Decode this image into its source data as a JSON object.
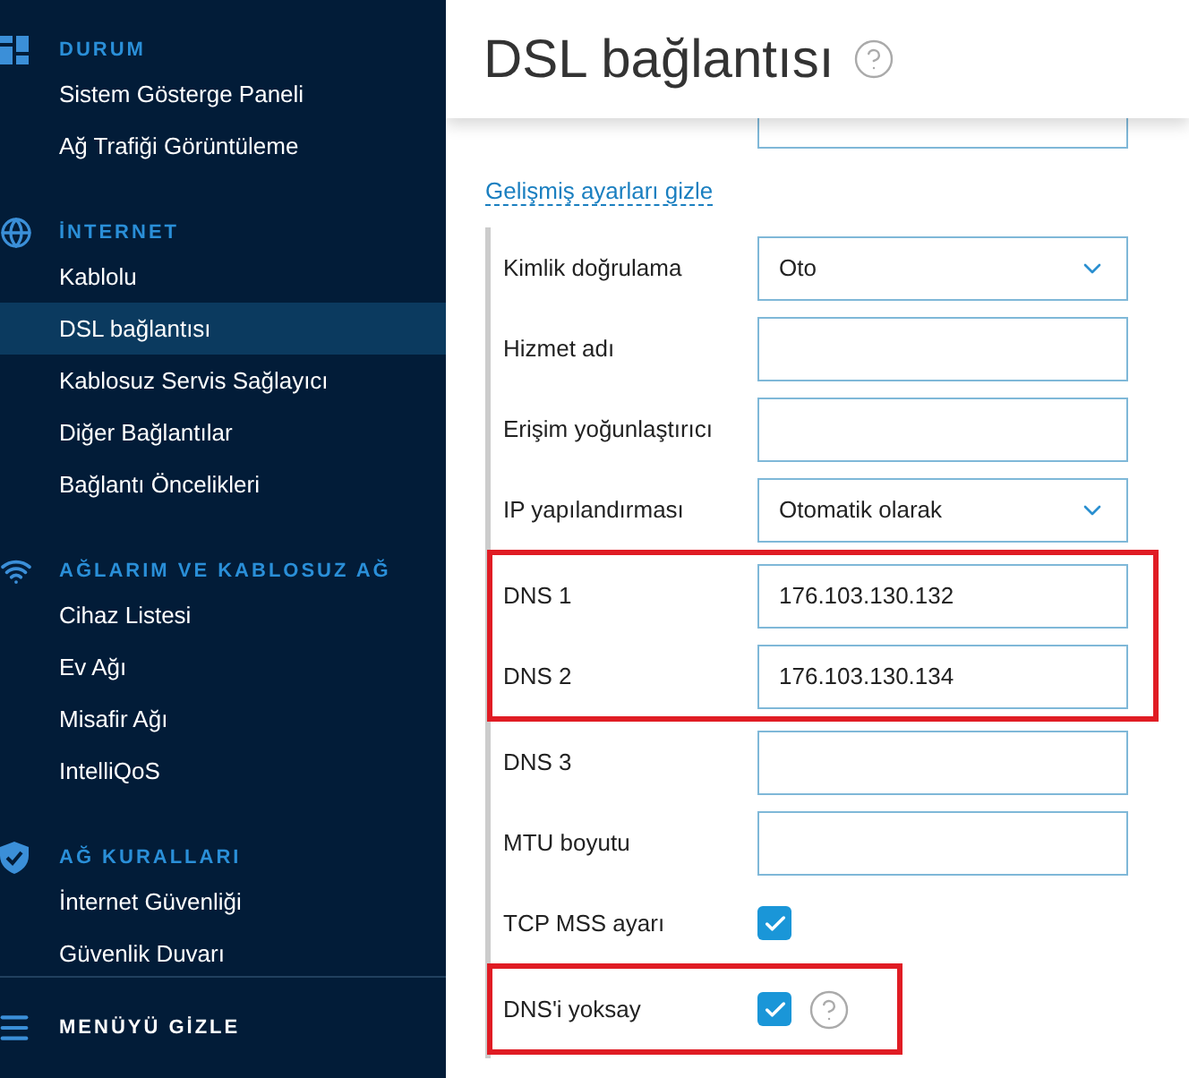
{
  "sidebar": {
    "sections": [
      {
        "kind": "dashboard",
        "title": "DURUM",
        "items": [
          {
            "label": "Sistem Gösterge Paneli",
            "selected": false
          },
          {
            "label": "Ağ Trafiği Görüntüleme",
            "selected": false
          }
        ]
      },
      {
        "kind": "globe",
        "title": "İNTERNET",
        "items": [
          {
            "label": "Kablolu",
            "selected": false
          },
          {
            "label": "DSL bağlantısı",
            "selected": true
          },
          {
            "label": "Kablosuz Servis Sağlayıcı",
            "selected": false
          },
          {
            "label": "Diğer Bağlantılar",
            "selected": false
          },
          {
            "label": "Bağlantı Öncelikleri",
            "selected": false
          }
        ]
      },
      {
        "kind": "wifi",
        "title": "AĞLARIM VE KABLOSUZ AĞ",
        "items": [
          {
            "label": "Cihaz Listesi",
            "selected": false
          },
          {
            "label": "Ev Ağı",
            "selected": false
          },
          {
            "label": "Misafir Ağı",
            "selected": false
          },
          {
            "label": "IntelliQoS",
            "selected": false
          }
        ]
      },
      {
        "kind": "shield",
        "title": "AĞ KURALLARI",
        "items": [
          {
            "label": "İnternet Güvenliği",
            "selected": false
          },
          {
            "label": "Güvenlik Duvarı",
            "selected": false
          }
        ]
      }
    ],
    "footer": "MENÜYÜ GİZLE"
  },
  "page": {
    "title": "DSL bağlantısı",
    "advanced_link": "Gelişmiş ayarları gizle",
    "groups": [
      {
        "highlighted": false,
        "fields": [
          {
            "kind": "select",
            "label": "Kimlik doğrulama",
            "value": "Oto"
          },
          {
            "kind": "text",
            "label": "Hizmet adı"
          },
          {
            "kind": "text",
            "label": "Erişim yoğunlaştırıcı"
          },
          {
            "kind": "select",
            "label": "IP yapılandırması",
            "value": "Otomatik olarak"
          }
        ]
      },
      {
        "highlighted": true,
        "fields": [
          {
            "kind": "text",
            "label": "DNS 1",
            "value": "176.103.130.132"
          },
          {
            "kind": "text",
            "label": "DNS 2",
            "value": "176.103.130.134"
          }
        ]
      },
      {
        "highlighted": false,
        "fields": [
          {
            "kind": "text",
            "label": "DNS 3"
          },
          {
            "kind": "text",
            "label": "MTU boyutu"
          },
          {
            "kind": "checkbox",
            "label": "TCP MSS ayarı",
            "checked": true
          }
        ]
      },
      {
        "highlighted": true,
        "fields": [
          {
            "kind": "checkbox",
            "label": "DNS'i yoksay",
            "checked": true,
            "help": true
          }
        ]
      }
    ]
  }
}
